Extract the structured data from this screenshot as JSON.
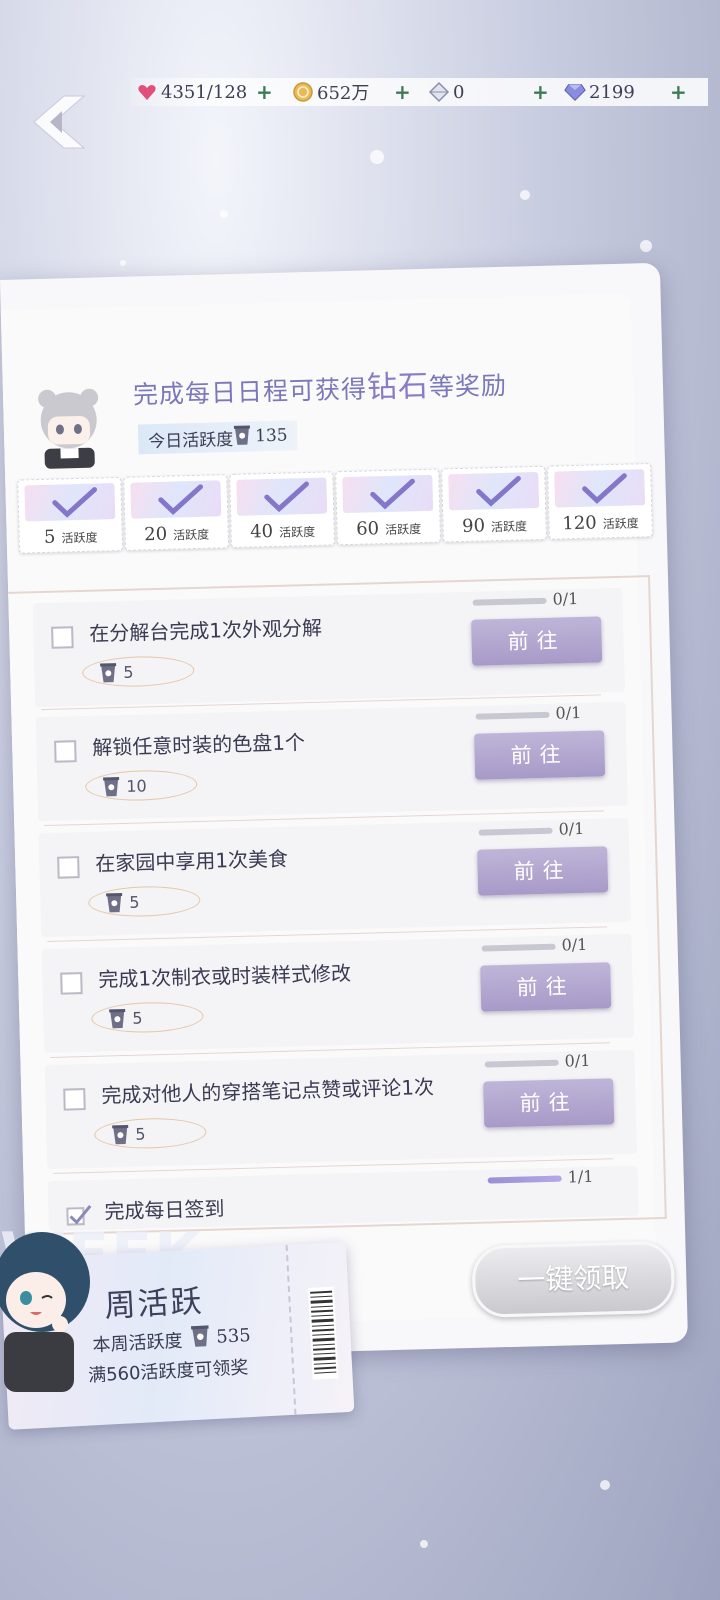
{
  "currencies": [
    {
      "icon": "heart-stamina-icon",
      "value": "4351/128"
    },
    {
      "icon": "gold-coin-icon",
      "value": "652万"
    },
    {
      "icon": "crystal-shard-icon",
      "value": "0"
    },
    {
      "icon": "diamond-icon",
      "value": "2199"
    }
  ],
  "header": {
    "title_pre": "完成每日日程可获得",
    "title_highlight": "钻石",
    "title_post": "等奖励",
    "today_label": "今日活跃度",
    "today_value": "135"
  },
  "rewards": [
    {
      "points": "5",
      "unit": "活跃度",
      "claimed": true
    },
    {
      "points": "20",
      "unit": "活跃度",
      "claimed": true
    },
    {
      "points": "40",
      "unit": "活跃度",
      "claimed": true
    },
    {
      "points": "60",
      "unit": "活跃度",
      "claimed": true
    },
    {
      "points": "90",
      "unit": "活跃度",
      "claimed": true
    },
    {
      "points": "120",
      "unit": "活跃度",
      "claimed": true
    }
  ],
  "tasks": [
    {
      "title": "在分解台完成1次外观分解",
      "points": "5",
      "progress": "0/1",
      "progress_fraction": 0.0,
      "button": "前往",
      "done": false
    },
    {
      "title": "解锁任意时装的色盘1个",
      "points": "10",
      "progress": "0/1",
      "progress_fraction": 0.0,
      "button": "前往",
      "done": false
    },
    {
      "title": "在家园中享用1次美食",
      "points": "5",
      "progress": "0/1",
      "progress_fraction": 0.0,
      "button": "前往",
      "done": false
    },
    {
      "title": "完成1次制衣或时装样式修改",
      "points": "5",
      "progress": "0/1",
      "progress_fraction": 0.0,
      "button": "前往",
      "done": false
    },
    {
      "title": "完成对他人的穿搭笔记点赞或评论1次",
      "points": "5",
      "progress": "0/1",
      "progress_fraction": 0.0,
      "button": "前往",
      "done": false
    },
    {
      "title": "完成每日签到",
      "points": "",
      "progress": "1/1",
      "progress_fraction": 1.0,
      "button": "",
      "done": true
    }
  ],
  "claim_all_button": "一键领取",
  "weekly": {
    "watermark": "WEEK",
    "title": "周活跃",
    "week_label": "本周活跃度",
    "week_value": "535",
    "hint": "满560活跃度可领奖"
  },
  "colors": {
    "accent": "#a89ac8",
    "progress_fill": "#9a8fd6",
    "title": "#7a78b8"
  }
}
